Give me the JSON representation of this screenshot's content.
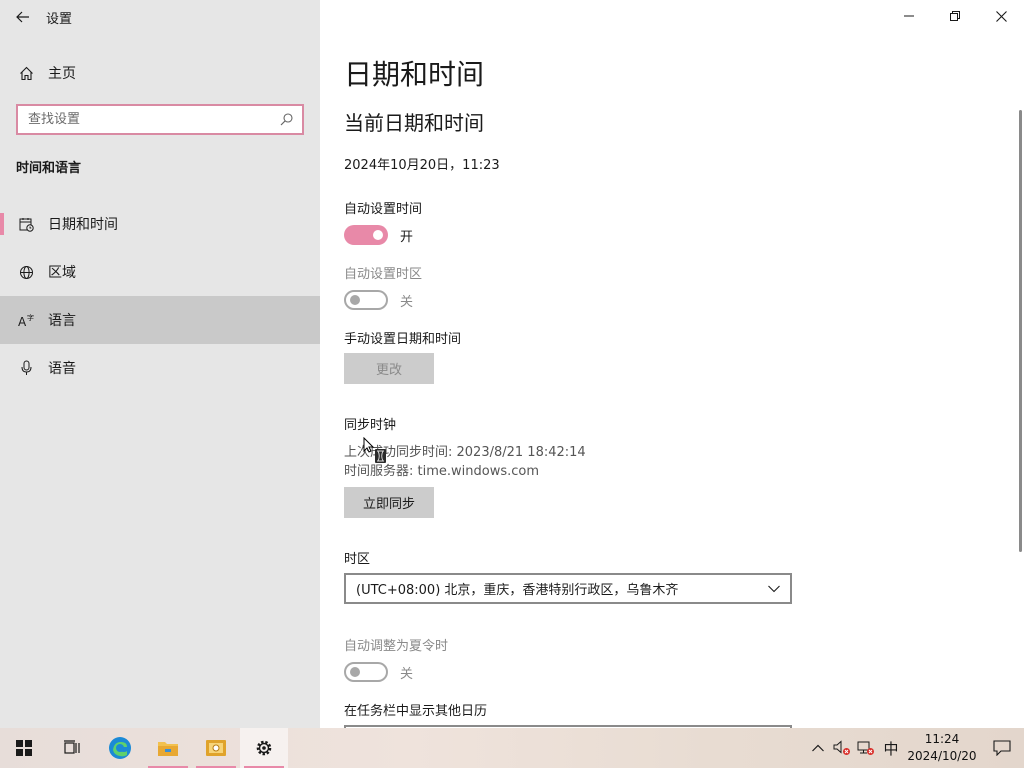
{
  "window": {
    "title": "设置"
  },
  "sidebar": {
    "home_label": "主页",
    "search_placeholder": "查找设置",
    "section_title": "时间和语言",
    "items": [
      {
        "label": "日期和时间",
        "icon": "calendar-clock-icon",
        "selected": true
      },
      {
        "label": "区域",
        "icon": "globe-icon",
        "selected": false
      },
      {
        "label": "语言",
        "icon": "language-icon",
        "selected": false,
        "hovered": true
      },
      {
        "label": "语音",
        "icon": "microphone-icon",
        "selected": false
      }
    ]
  },
  "main": {
    "page_title": "日期和时间",
    "subtitle": "当前日期和时间",
    "current_datetime": "2024年10月20日，11:23",
    "auto_time": {
      "label": "自动设置时间",
      "state": "开",
      "on": true
    },
    "auto_timezone": {
      "label": "自动设置时区",
      "state": "关",
      "on": false,
      "disabled": true
    },
    "manual": {
      "label": "手动设置日期和时间",
      "button": "更改"
    },
    "sync": {
      "label": "同步时钟",
      "last_sync": "上次成功同步时间: 2023/8/21 18:42:14",
      "time_server": "时间服务器: time.windows.com",
      "button": "立即同步"
    },
    "timezone": {
      "label": "时区",
      "value": "(UTC+08:00) 北京，重庆，香港特别行政区，乌鲁木齐"
    },
    "dst": {
      "label": "自动调整为夏令时",
      "state": "关",
      "on": false,
      "disabled": true
    },
    "other_calendar": {
      "label": "在任务栏中显示其他日历"
    }
  },
  "taskbar": {
    "apps": [
      "start-icon",
      "task-view-icon",
      "edge-icon",
      "file-explorer-icon",
      "photo-app-icon",
      "settings-icon"
    ],
    "ime": "中",
    "clock_time": "11:24",
    "clock_date": "2024/10/20"
  },
  "colors": {
    "accent": "#e889a8",
    "sidebar_bg": "#e6e6e6",
    "hover_bg": "#c9c9c9"
  }
}
